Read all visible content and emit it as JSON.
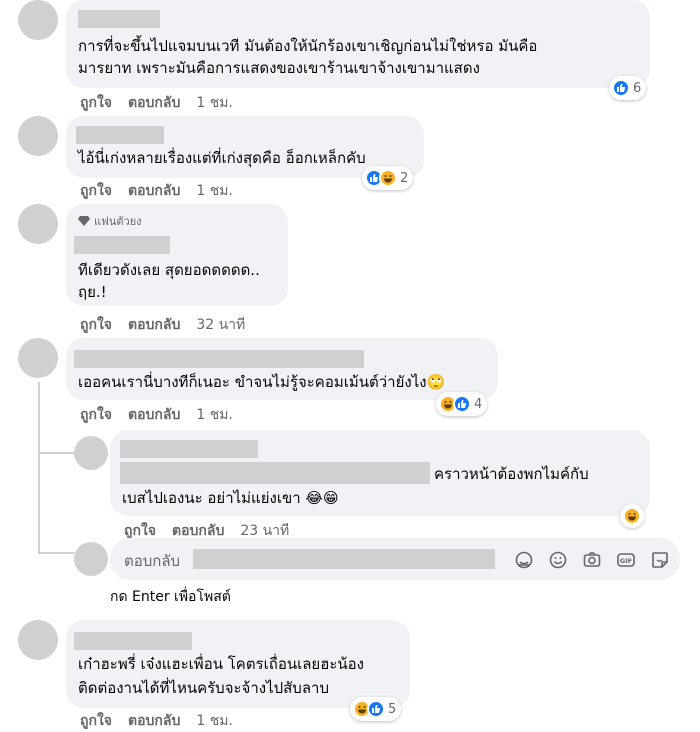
{
  "actions": {
    "like": "ถูกใจ",
    "reply": "ตอบกลับ"
  },
  "comments": [
    {
      "lines": [
        "การที่จะขึ้นไปแจมบนเวที มันต้องให้นักร้องเขาเชิญก่อนไม่ใช่หรอ มันคือ",
        "มารยาท เพราะมันคือการแสดงของเขาร้านเขาจ้างเขามาแสดง"
      ],
      "time": "1 ชม.",
      "reaction_count": "6"
    },
    {
      "lines": [
        "ไอ้นี่เก่งหลายเรื่องแต่ที่เก่งสุดคือ อ็อกเหล็กคับ"
      ],
      "time": "1 ชม.",
      "reaction_count": "2"
    },
    {
      "badge": "แฟนตัวยง",
      "lines": [
        "ทีเดียวดังเลย สุดยอดดดดด..",
        "ฤย.!"
      ],
      "time": "32 นาที"
    },
    {
      "lines": [
        "เออคนเรานี่บางทีก็เนอะ ขำจนไม่รู้จะคอมเม้นต์ว่ายังไง🙄"
      ],
      "time": "1 ชม.",
      "reaction_count": "4"
    },
    {
      "lines": [
        "คราวหน้าต้องพกไมค์กับ",
        "เบสไปเองนะ อย่าไม่แย่งเขา 😂😁"
      ],
      "time": "23 นาที"
    },
    {
      "lines": [
        "เก๋าฮะพรี่ เจ๋งแฮะเพื่อน โคตรเถื่อนเลยฮะน้อง",
        "ติดต่องานได้ที่ไหนครับจะจ้างไปสับลาบ"
      ],
      "time": "1 ชม.",
      "reaction_count": "5"
    }
  ],
  "reply_box": {
    "placeholder": "ตอบกลับ",
    "icons": [
      "avatar-sticker-icon",
      "emoji-icon",
      "camera-icon",
      "gif-icon",
      "sticker-icon"
    ]
  },
  "enter_hint": "กด Enter เพื่อโพสต์",
  "colors": {
    "bubble": "#f0f2f5",
    "redact": "#cfd0d2",
    "like": "#1877f2",
    "haha": "#f7b125",
    "meta": "#65676b"
  }
}
